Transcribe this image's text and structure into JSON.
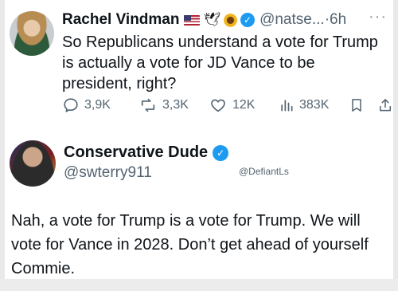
{
  "tweet_top": {
    "author_name": "Rachel Vindman",
    "handle": "@natse...",
    "separator": "·",
    "time": "6h",
    "more": "···",
    "text": "So Republicans understand a vote for Trump is actually a vote for JD Vance to be president, right?",
    "actions": {
      "replies": "3,9K",
      "reposts": "3,3K",
      "likes": "12K",
      "views": "383K"
    }
  },
  "tweet_reply": {
    "author_name": "Conservative Dude",
    "handle": "@swterry911",
    "watermark": "@DefiantLs",
    "text": "Nah, a vote for Trump is a vote for Trump. We will vote for Vance in 2028. Don’t get ahead of yourself Commie."
  },
  "icons": {
    "flag": "us-flag-icon",
    "eagle": "eagle-icon",
    "sunflower": "sunflower-icon",
    "verified": "verified-badge-icon",
    "reply": "reply-icon",
    "repost": "repost-icon",
    "like": "heart-icon",
    "views": "views-icon",
    "bookmark": "bookmark-icon",
    "share": "share-icon"
  },
  "colors": {
    "verified": "#1d9bf0",
    "text": "#0f1419",
    "muted": "#536471"
  }
}
